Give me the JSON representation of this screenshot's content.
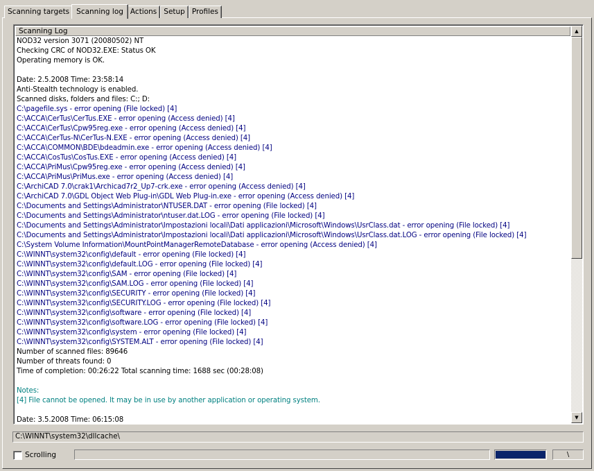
{
  "tabs": [
    {
      "label": "Scanning targets",
      "active": false
    },
    {
      "label": "Scanning log",
      "active": true
    },
    {
      "label": "Actions",
      "active": false
    },
    {
      "label": "Setup",
      "active": false
    },
    {
      "label": "Profiles",
      "active": false
    }
  ],
  "log": {
    "header": "Scanning Log",
    "lines": [
      {
        "text": "NOD32 version 3071 (20080502) NT",
        "color": "black"
      },
      {
        "text": "Checking CRC of NOD32.EXE: Status OK",
        "color": "black"
      },
      {
        "text": "Operating memory is OK.",
        "color": "black"
      },
      {
        "text": "",
        "color": "black"
      },
      {
        "text": "Date: 2.5.2008  Time: 23:58:14",
        "color": "black"
      },
      {
        "text": "Anti-Stealth technology is enabled.",
        "color": "black"
      },
      {
        "text": "Scanned disks, folders and files: C:; D:",
        "color": "black"
      },
      {
        "text": "C:\\pagefile.sys - error opening (File locked) [4]",
        "color": "blue"
      },
      {
        "text": "C:\\ACCA\\CerTus\\CerTus.EXE - error opening (Access denied) [4]",
        "color": "blue"
      },
      {
        "text": "C:\\ACCA\\CerTus\\Cpw95reg.exe - error opening (Access denied) [4]",
        "color": "blue"
      },
      {
        "text": "C:\\ACCA\\CerTus-N\\CerTus-N.EXE - error opening (Access denied) [4]",
        "color": "blue"
      },
      {
        "text": "C:\\ACCA\\COMMON\\BDE\\bdeadmin.exe - error opening (Access denied) [4]",
        "color": "blue"
      },
      {
        "text": "C:\\ACCA\\CosTus\\CosTus.EXE - error opening (Access denied) [4]",
        "color": "blue"
      },
      {
        "text": "C:\\ACCA\\PriMus\\Cpw95reg.exe - error opening (Access denied) [4]",
        "color": "blue"
      },
      {
        "text": "C:\\ACCA\\PriMus\\PriMus.exe - error opening (Access denied) [4]",
        "color": "blue"
      },
      {
        "text": "C:\\ArchiCAD 7.0\\crak1\\Archicad7r2_Up7-crk.exe - error opening (Access denied) [4]",
        "color": "blue"
      },
      {
        "text": "C:\\ArchiCAD 7.0\\GDL Object Web Plug-in\\GDL Web Plug-in.exe - error opening (Access denied) [4]",
        "color": "blue"
      },
      {
        "text": "C:\\Documents and Settings\\Administrator\\NTUSER.DAT - error opening (File locked) [4]",
        "color": "blue"
      },
      {
        "text": "C:\\Documents and Settings\\Administrator\\ntuser.dat.LOG - error opening (File locked) [4]",
        "color": "blue"
      },
      {
        "text": "C:\\Documents and Settings\\Administrator\\Impostazioni locali\\Dati applicazioni\\Microsoft\\Windows\\UsrClass.dat - error opening (File locked) [4]",
        "color": "blue"
      },
      {
        "text": "C:\\Documents and Settings\\Administrator\\Impostazioni locali\\Dati applicazioni\\Microsoft\\Windows\\UsrClass.dat.LOG - error opening (File locked) [4]",
        "color": "blue"
      },
      {
        "text": "C:\\System Volume Information\\MountPointManagerRemoteDatabase - error opening (Access denied) [4]",
        "color": "blue"
      },
      {
        "text": "C:\\WINNT\\system32\\config\\default - error opening (File locked) [4]",
        "color": "blue"
      },
      {
        "text": "C:\\WINNT\\system32\\config\\default.LOG - error opening (File locked) [4]",
        "color": "blue"
      },
      {
        "text": "C:\\WINNT\\system32\\config\\SAM - error opening (File locked) [4]",
        "color": "blue"
      },
      {
        "text": "C:\\WINNT\\system32\\config\\SAM.LOG - error opening (File locked) [4]",
        "color": "blue"
      },
      {
        "text": "C:\\WINNT\\system32\\config\\SECURITY - error opening (File locked) [4]",
        "color": "blue"
      },
      {
        "text": "C:\\WINNT\\system32\\config\\SECURITY.LOG - error opening (File locked) [4]",
        "color": "blue"
      },
      {
        "text": "C:\\WINNT\\system32\\config\\software - error opening (File locked) [4]",
        "color": "blue"
      },
      {
        "text": "C:\\WINNT\\system32\\config\\software.LOG - error opening (File locked) [4]",
        "color": "blue"
      },
      {
        "text": "C:\\WINNT\\system32\\config\\system - error opening (File locked) [4]",
        "color": "blue"
      },
      {
        "text": "C:\\WINNT\\system32\\config\\SYSTEM.ALT - error opening (File locked) [4]",
        "color": "blue"
      },
      {
        "text": "Number of scanned files: 89646",
        "color": "black"
      },
      {
        "text": "Number of threats found: 0",
        "color": "black"
      },
      {
        "text": "Time of completion: 00:26:22 Total scanning time: 1688 sec (00:28:08)",
        "color": "black"
      },
      {
        "text": "",
        "color": "black"
      },
      {
        "text": "Notes:",
        "color": "teal"
      },
      {
        "text": "[4] File cannot be opened. It may be in use by another application or operating system.",
        "color": "teal"
      },
      {
        "text": "",
        "color": "black"
      },
      {
        "text": "Date: 3.5.2008  Time: 06:15:08",
        "color": "black"
      }
    ]
  },
  "status": {
    "current_path": "C:\\WINNT\\system32\\dllcache\\",
    "scrolling_label": "Scrolling",
    "scrolling_checked": false,
    "progress_fraction": 0.0,
    "spinner": "\\"
  },
  "colors": {
    "black": "#000000",
    "blue": "#000080",
    "teal": "#008080"
  }
}
